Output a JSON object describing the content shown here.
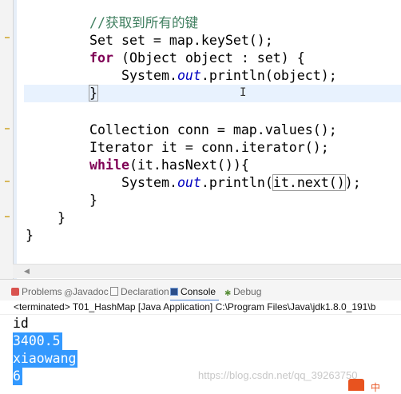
{
  "code": {
    "comment": "//获取到所有的键",
    "line_set": "Set set = map.keySet();",
    "for_kw": "for",
    "for_rest": " (Object object : set) {",
    "println1_a": "System.",
    "println1_field": "out",
    "println1_b": ".println(object);",
    "close_brace_1": "}",
    "line_collection": "Collection conn = map.values();",
    "line_iterator": "Iterator it = conn.iterator();",
    "while_kw": "while",
    "while_rest": "(it.hasNext()){",
    "println2_a": "System.",
    "println2_field": "out",
    "println2_b": ".println(",
    "println2_arg": "it.next()",
    "println2_c": ");",
    "close_brace_2": "}",
    "close_brace_3": "}",
    "close_brace_4": "}",
    "cursor_glyph": "I"
  },
  "tabs": [
    {
      "label": "Problems",
      "icon": "problems-icon"
    },
    {
      "label": "Javadoc",
      "icon": "javadoc-icon"
    },
    {
      "label": "Declaration",
      "icon": "declaration-icon"
    },
    {
      "label": "Console",
      "icon": "console-icon",
      "active": true
    },
    {
      "label": "Debug",
      "icon": "debug-icon"
    }
  ],
  "console": {
    "status": "<terminated> T01_HashMap [Java Application] C:\\Program Files\\Java\\jdk1.8.0_191\\b",
    "lines": [
      "id",
      "3400.5",
      "xiaowang",
      "6"
    ]
  },
  "watermark": "https://blog.csdn.net/qq_39263750_",
  "logo_text": "中",
  "colors": {
    "keyword": "#7f0055",
    "comment": "#3f7f5f",
    "field": "#0000c0",
    "selection": "#3399ff"
  }
}
